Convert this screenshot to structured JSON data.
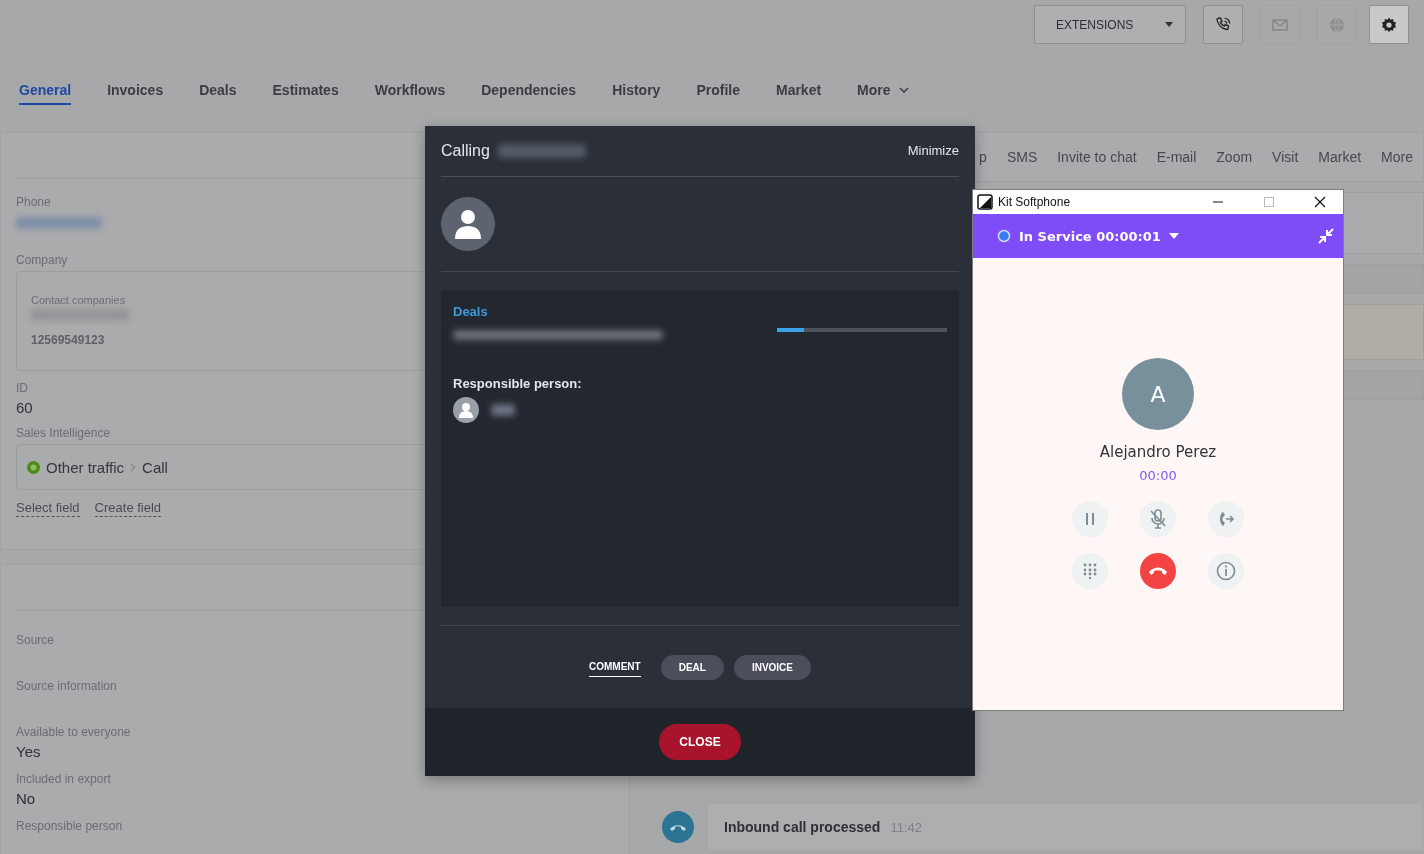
{
  "header": {
    "extensions_button": "EXTENSIONS",
    "icon_buttons": [
      {
        "kind": "phone",
        "disabled": false
      },
      {
        "kind": "mail",
        "disabled": true
      },
      {
        "kind": "globe",
        "disabled": true
      },
      {
        "kind": "settings",
        "disabled": false
      }
    ]
  },
  "tabs": [
    {
      "label": "General",
      "selected": true
    },
    {
      "label": "Invoices",
      "selected": false
    },
    {
      "label": "Deals",
      "selected": false
    },
    {
      "label": "Estimates",
      "selected": false
    },
    {
      "label": "Workflows",
      "selected": false
    },
    {
      "label": "Dependencies",
      "selected": false
    },
    {
      "label": "History",
      "selected": false
    },
    {
      "label": "Profile",
      "selected": false
    },
    {
      "label": "Market",
      "selected": false
    },
    {
      "label": "More",
      "selected": false
    }
  ],
  "details_card": {
    "fields": [
      {
        "kind": "redacted",
        "label": "Phone"
      },
      {
        "kind": "company",
        "label": "Company",
        "box_title": "Contact companies",
        "number": "12569549123"
      },
      {
        "kind": "value",
        "label": "ID",
        "value": "60"
      },
      {
        "kind": "source",
        "label": "Sales Intelligence",
        "source": "Other traffic",
        "channel": "Call"
      }
    ],
    "links": [
      "Select field",
      "Create field"
    ]
  },
  "more_card": {
    "fields": [
      {
        "kind": "empty",
        "label": "Source"
      },
      {
        "kind": "empty",
        "label": "Source information"
      },
      {
        "kind": "value",
        "label": "Available to everyone",
        "value": "Yes"
      },
      {
        "kind": "value",
        "label": "Included in export",
        "value": "No"
      },
      {
        "kind": "empty",
        "label": "Responsible person"
      }
    ]
  },
  "action_tabs": [
    "p",
    "SMS",
    "Invite to chat",
    "E-mail",
    "Zoom",
    "Visit",
    "Market",
    "More"
  ],
  "timeline": {
    "title": "Inbound call processed",
    "time": "11:42"
  },
  "call_dialog": {
    "title": "Calling",
    "minimize": "Minimize",
    "deals_heading": "Deals",
    "deal_progress": {
      "level": 0.16
    },
    "responsible_label": "Responsible person:",
    "tabs": [
      {
        "label": "COMMENT",
        "selected": true
      },
      {
        "label": "DEAL",
        "selected": false
      },
      {
        "label": "INVOICE",
        "selected": false
      }
    ],
    "close_button": "CLOSE"
  },
  "softphone": {
    "window_title": "Kit Softphone",
    "status": "In Service 00:00:01",
    "avatar_letter": "A",
    "caller": "Alejandro Perez",
    "duration": "00:00",
    "controls": [
      {
        "kind": "pause"
      },
      {
        "kind": "mute"
      },
      {
        "kind": "transfer"
      },
      {
        "kind": "dialpad"
      },
      {
        "kind": "hangup"
      },
      {
        "kind": "info"
      }
    ]
  }
}
